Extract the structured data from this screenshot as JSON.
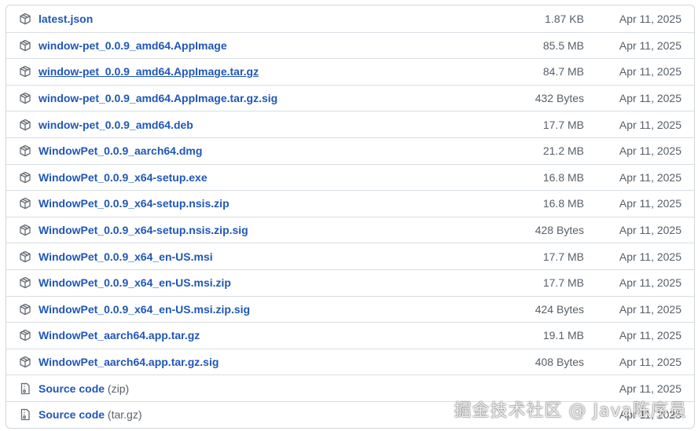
{
  "assets": [
    {
      "name": "latest.json",
      "size": "1.87 KB",
      "date": "Apr 11, 2025",
      "icon": "package-icon"
    },
    {
      "name": "window-pet_0.0.9_amd64.AppImage",
      "size": "85.5 MB",
      "date": "Apr 11, 2025",
      "icon": "package-icon"
    },
    {
      "name": "window-pet_0.0.9_amd64.AppImage.tar.gz",
      "size": "84.7 MB",
      "date": "Apr 11, 2025",
      "icon": "package-icon"
    },
    {
      "name": "window-pet_0.0.9_amd64.AppImage.tar.gz.sig",
      "size": "432 Bytes",
      "date": "Apr 11, 2025",
      "icon": "package-icon"
    },
    {
      "name": "window-pet_0.0.9_amd64.deb",
      "size": "17.7 MB",
      "date": "Apr 11, 2025",
      "icon": "package-icon"
    },
    {
      "name": "WindowPet_0.0.9_aarch64.dmg",
      "size": "21.2 MB",
      "date": "Apr 11, 2025",
      "icon": "package-icon"
    },
    {
      "name": "WindowPet_0.0.9_x64-setup.exe",
      "size": "16.8 MB",
      "date": "Apr 11, 2025",
      "icon": "package-icon"
    },
    {
      "name": "WindowPet_0.0.9_x64-setup.nsis.zip",
      "size": "16.8 MB",
      "date": "Apr 11, 2025",
      "icon": "package-icon"
    },
    {
      "name": "WindowPet_0.0.9_x64-setup.nsis.zip.sig",
      "size": "428 Bytes",
      "date": "Apr 11, 2025",
      "icon": "package-icon"
    },
    {
      "name": "WindowPet_0.0.9_x64_en-US.msi",
      "size": "17.7 MB",
      "date": "Apr 11, 2025",
      "icon": "package-icon"
    },
    {
      "name": "WindowPet_0.0.9_x64_en-US.msi.zip",
      "size": "17.7 MB",
      "date": "Apr 11, 2025",
      "icon": "package-icon"
    },
    {
      "name": "WindowPet_0.0.9_x64_en-US.msi.zip.sig",
      "size": "424 Bytes",
      "date": "Apr 11, 2025",
      "icon": "package-icon"
    },
    {
      "name": "WindowPet_aarch64.app.tar.gz",
      "size": "19.1 MB",
      "date": "Apr 11, 2025",
      "icon": "package-icon"
    },
    {
      "name": "WindowPet_aarch64.app.tar.gz.sig",
      "size": "408 Bytes",
      "date": "Apr 11, 2025",
      "icon": "package-icon"
    }
  ],
  "source": [
    {
      "label": "Source code",
      "suffix": "(zip)",
      "date": "Apr 11, 2025",
      "icon": "file-zip-icon"
    },
    {
      "label": "Source code",
      "suffix": "(tar.gz)",
      "date": "Apr 11, 2025",
      "icon": "file-zip-icon"
    }
  ],
  "watermark": "掘金技术社区 @ Java陈序员",
  "colors": {
    "link": "#1f57b8",
    "muted": "#57606a",
    "border": "#d0d7de"
  }
}
